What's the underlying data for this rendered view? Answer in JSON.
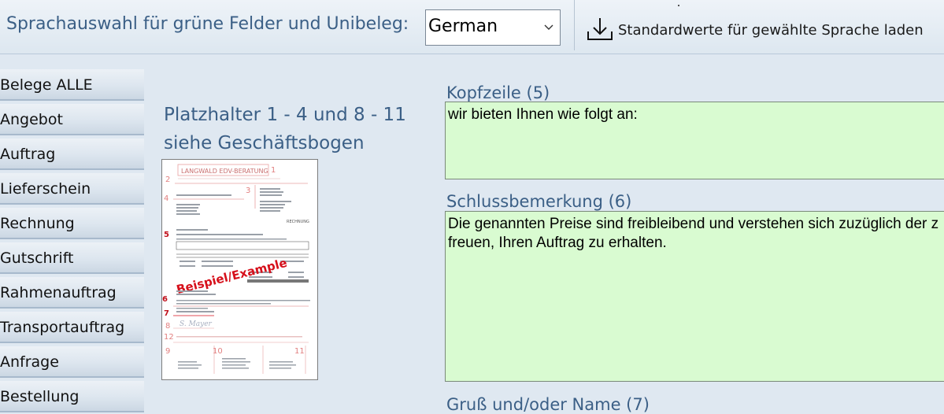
{
  "toolbar": {
    "language_label": "Sprachauswahl für grüne Felder und Unibeleg:",
    "language_value": "German",
    "load_button_label": "Standardwerte für gewählte Sprache laden"
  },
  "sidebar": {
    "items": [
      {
        "label": "Belege ALLE"
      },
      {
        "label": "Angebot"
      },
      {
        "label": "Auftrag"
      },
      {
        "label": "Lieferschein"
      },
      {
        "label": "Rechnung"
      },
      {
        "label": "Gutschrift"
      },
      {
        "label": "Rahmenauftrag"
      },
      {
        "label": "Transportauftrag"
      },
      {
        "label": "Anfrage"
      },
      {
        "label": "Bestellung"
      }
    ]
  },
  "placeholder_info": {
    "line1": "Platzhalter 1 - 4 und 8 - 11",
    "line2": "siehe Geschäftsbogen"
  },
  "thumbnail": {
    "company": "LANGWALD EDV-BERATUNG",
    "doc_type": "RECHNUNG",
    "stamp": "Beispiel/Example",
    "signature": "S. Mayer",
    "markers": [
      "1",
      "2",
      "3",
      "4",
      "5",
      "6",
      "7",
      "8",
      "9",
      "10",
      "11",
      "12"
    ]
  },
  "fields": {
    "kopfzeile": {
      "label": "Kopfzeile (5)",
      "value": "wir bieten Ihnen wie folgt an:"
    },
    "schlussbemerkung": {
      "label": "Schlussbemerkung (6)",
      "value": "Die genannten Preise sind freibleibend und verstehen sich zuzüglich der z\nfreuen, Ihren Auftrag zu erhalten."
    },
    "gruss": {
      "label": "Gruß und/oder Name (7)"
    }
  },
  "colors": {
    "accent_text": "#3b5f86",
    "field_bg": "#d9fbd1",
    "marker_red": "#d6101b"
  }
}
